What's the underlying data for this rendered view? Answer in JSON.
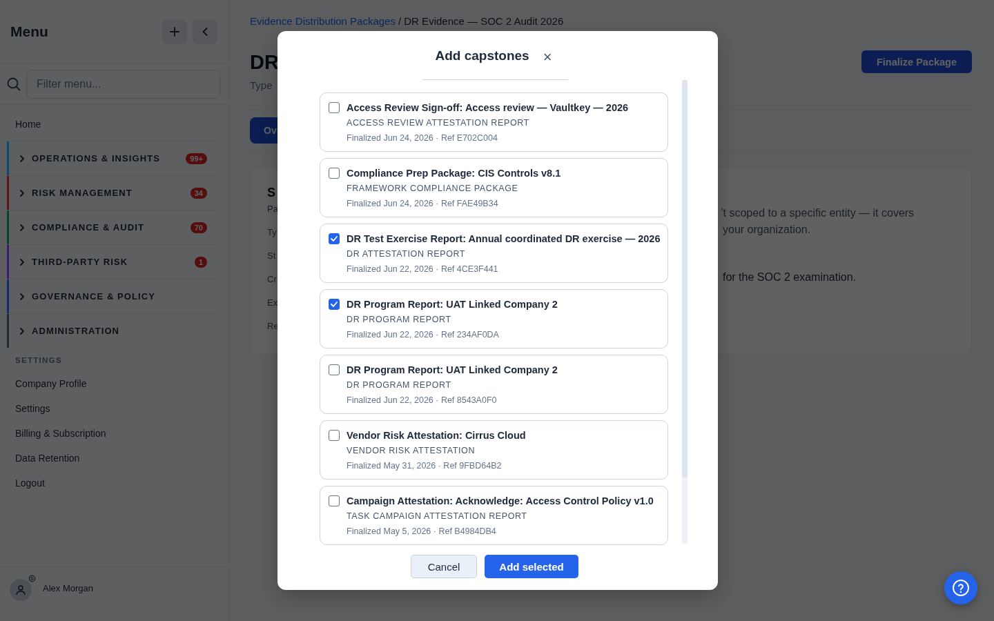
{
  "sidebar": {
    "title": "Menu",
    "filter": {
      "placeholder": "Filter menu..."
    },
    "home": "Home",
    "groups": [
      {
        "label": "OPERATIONS & INSIGHTS",
        "color": "#0a4c6b",
        "badge": "99+",
        "expanded": false
      },
      {
        "label": "RISK MANAGEMENT",
        "color": "#651111",
        "badge": "34",
        "expanded": false
      },
      {
        "label": "COMPLIANCE & AUDIT",
        "color": "#024530",
        "badge": "70",
        "expanded": false
      },
      {
        "label": "THIRD-PARTY RISK",
        "color": "#391b6d",
        "badge": "1",
        "expanded": false
      },
      {
        "label": "GOVERNANCE & POLICY",
        "color": "#112d6c",
        "expanded": false
      },
      {
        "label": "ADMINISTRATION",
        "color": "#212730",
        "expanded": false
      }
    ],
    "settings_heading": "SETTINGS",
    "settings_links": [
      "Company Profile",
      "Settings",
      "Billing & Subscription",
      "Data Retention",
      "Logout"
    ],
    "user": {
      "name": "Alex Morgan"
    }
  },
  "page": {
    "breadcrumb": [
      {
        "label": "Evidence Distribution Packages",
        "kind": "link"
      },
      {
        "label": "/ DR Evidence — SOC 2 Audit 2026",
        "kind": "current"
      }
    ],
    "title": "DR",
    "subtitle": "Type",
    "primary_action": "Finalize Package",
    "tab": "Ov",
    "summary": {
      "heading": "S",
      "labels": [
        "Pa",
        "Ty",
        "St",
        "Cr",
        "Ex",
        "Re"
      ],
      "notes": [
        "’t scoped to a specific entity — it covers",
        "your organization.",
        "for the SOC 2 examination."
      ]
    }
  },
  "modal": {
    "title": "Add capstones",
    "close": "×",
    "capstones": [
      {
        "title": "Access Review Sign-off: Access review — Vaultkey — 2026",
        "type": "ACCESS REVIEW ATTESTATION REPORT",
        "meta": "Finalized Jun 24, 2026 · Ref E702C004",
        "selected": false
      },
      {
        "title": "Compliance Prep Package: CIS Controls v8.1",
        "type": "FRAMEWORK COMPLIANCE PACKAGE",
        "meta": "Finalized Jun 24, 2026 · Ref FAE49B34",
        "selected": false
      },
      {
        "title": "DR Test Exercise Report: Annual coordinated DR exercise — 2026",
        "type": "DR ATTESTATION REPORT",
        "meta": "Finalized Jun 22, 2026 · Ref 4CE3F441",
        "selected": true
      },
      {
        "title": "DR Program Report: UAT Linked Company 2",
        "type": "DR PROGRAM REPORT",
        "meta": "Finalized Jun 22, 2026 · Ref 234AF0DA",
        "selected": true
      },
      {
        "title": "DR Program Report: UAT Linked Company 2",
        "type": "DR PROGRAM REPORT",
        "meta": "Finalized Jun 22, 2026 · Ref 8543A0F0",
        "selected": false
      },
      {
        "title": "Vendor Risk Attestation: Cirrus Cloud",
        "type": "VENDOR RISK ATTESTATION",
        "meta": "Finalized May 31, 2026 · Ref 9FBD64B2",
        "selected": false
      },
      {
        "title": "Campaign Attestation: Acknowledge: Access Control Policy v1.0",
        "type": "TASK CAMPAIGN ATTESTATION REPORT",
        "meta": "Finalized May 5, 2026 · Ref B4984DB4",
        "selected": false
      }
    ],
    "buttons": {
      "cancel": "Cancel",
      "confirm": "Add selected"
    }
  }
}
